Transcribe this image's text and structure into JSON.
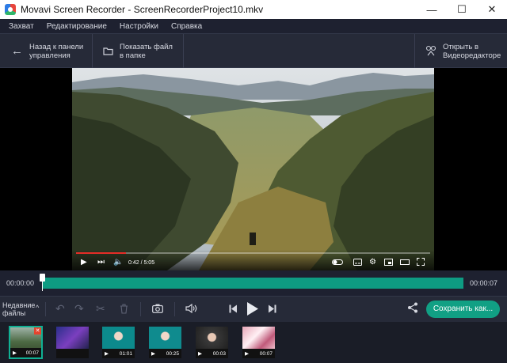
{
  "window": {
    "title": "Movavi Screen Recorder - ScreenRecorderProject10.mkv",
    "minimize": "—",
    "maximize": "☐",
    "close": "✕"
  },
  "menu": [
    "Захват",
    "Редактирование",
    "Настройки",
    "Справка"
  ],
  "toolbar": {
    "back_line1": "Назад к панели",
    "back_line2": "управления",
    "show_line1": "Показать файл",
    "show_line2": "в папке",
    "open_line1": "Открыть в",
    "open_line2": "Видеоредакторе"
  },
  "player": {
    "time": "0:42 / 5:05",
    "progress": 0.14
  },
  "timeline": {
    "start": "00:00:00",
    "end": "00:00:07"
  },
  "controls": {
    "recent_line1": "Недавние",
    "recent_line2": "файлы",
    "save_label": "Сохранить как..."
  },
  "recent_files": [
    {
      "duration": "00:07",
      "selected": true
    },
    {
      "duration": "",
      "selected": false
    },
    {
      "duration": "01:01",
      "selected": false
    },
    {
      "duration": "00:25",
      "selected": false
    },
    {
      "duration": "00:03",
      "selected": false
    },
    {
      "duration": "00:07",
      "selected": false
    }
  ],
  "colors": {
    "accent": "#11a084",
    "timeline": "#0e9b82",
    "yt_progress": "#e52d27",
    "delete": "#e5442e"
  }
}
